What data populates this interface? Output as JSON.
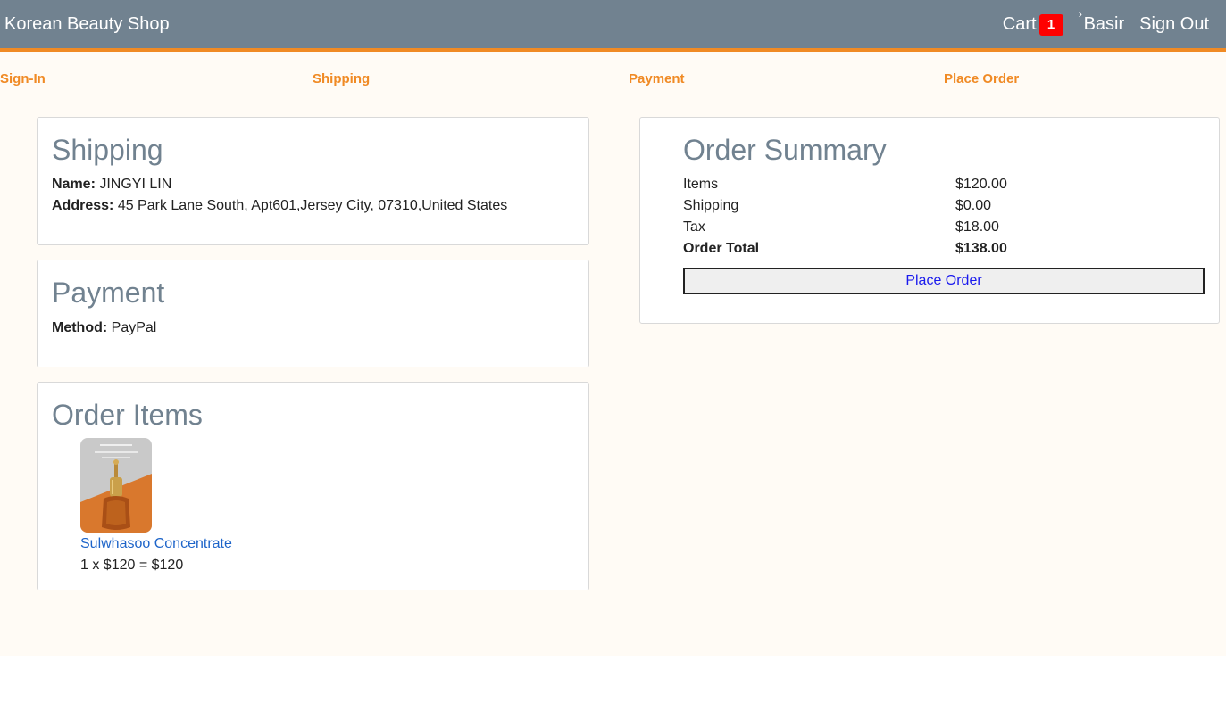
{
  "header": {
    "brand": "Korean Beauty Shop",
    "cart_label": "Cart",
    "cart_count": "1",
    "user_name": "Basir",
    "user_caret": "›",
    "signout_label": "Sign Out"
  },
  "steps": [
    "Sign-In",
    "Shipping",
    "Payment",
    "Place Order"
  ],
  "shipping": {
    "title": "Shipping",
    "name_label": "Name:",
    "name_value": "JINGYI LIN",
    "address_label": "Address:",
    "address_value": "45 Park Lane South, Apt601,Jersey City, 07310,United States"
  },
  "payment": {
    "title": "Payment",
    "method_label": "Method:",
    "method_value": "PayPal"
  },
  "order_items": {
    "title": "Order Items",
    "items": [
      {
        "name": "Sulwhasoo Concentrate",
        "line": "1 x $120 = $120"
      }
    ]
  },
  "summary": {
    "title": "Order Summary",
    "rows": [
      {
        "label": "Items",
        "value": "$120.00"
      },
      {
        "label": "Shipping",
        "value": "$0.00"
      },
      {
        "label": "Tax",
        "value": "$18.00"
      },
      {
        "label": "Order Total",
        "value": "$138.00"
      }
    ],
    "button_label": "Place Order"
  },
  "colors": {
    "header_bg": "#718290",
    "accent": "#f08a24",
    "badge": "#ff0000",
    "link": "#1d64c9"
  }
}
